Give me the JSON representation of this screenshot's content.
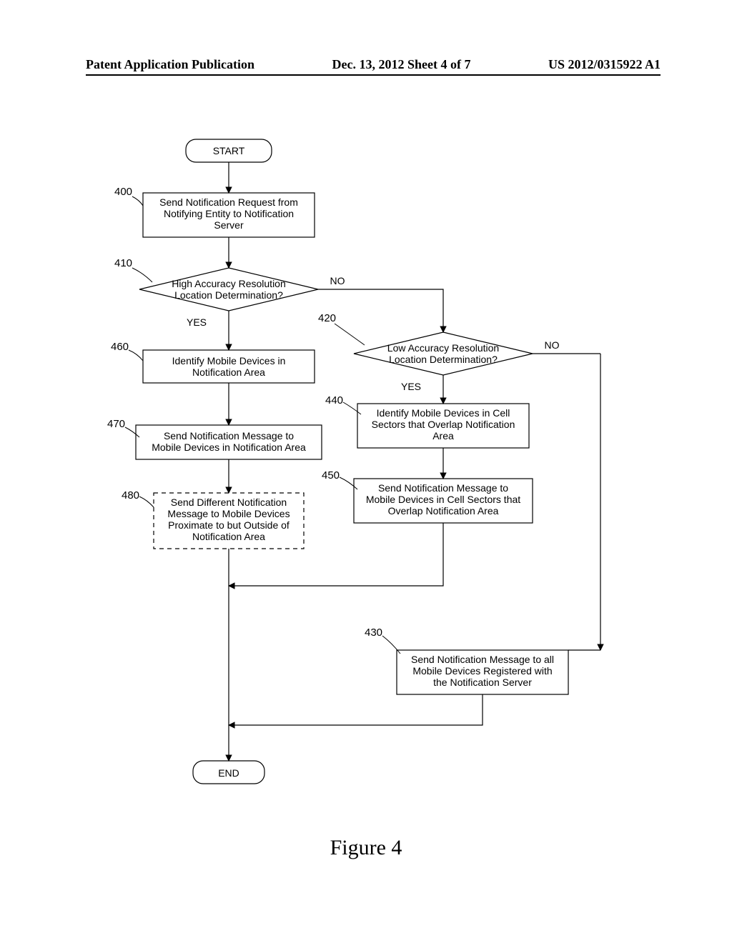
{
  "header": {
    "left": "Patent Application Publication",
    "center": "Dec. 13, 2012  Sheet 4 of 7",
    "right": "US 2012/0315922 A1"
  },
  "figure_caption": "Figure 4",
  "refs": {
    "r400": "400",
    "r410": "410",
    "r420": "420",
    "r430": "430",
    "r440": "440",
    "r450": "450",
    "r460": "460",
    "r470": "470",
    "r480": "480"
  },
  "labels": {
    "yes": "YES",
    "no": "NO"
  },
  "nodes": {
    "start": "START",
    "end": "END",
    "n400_l1": "Send Notification Request from",
    "n400_l2": "Notifying Entity to Notification",
    "n400_l3": "Server",
    "n410_l1": "High Accuracy Resolution",
    "n410_l2": "Location Determination?",
    "n420_l1": "Low Accuracy Resolution",
    "n420_l2": "Location Determination?",
    "n430_l1": "Send Notification Message to all",
    "n430_l2": "Mobile Devices Registered with",
    "n430_l3": "the Notification Server",
    "n440_l1": "Identify Mobile Devices in Cell",
    "n440_l2": "Sectors that Overlap Notification",
    "n440_l3": "Area",
    "n450_l1": "Send Notification Message to",
    "n450_l2": "Mobile Devices in Cell Sectors that",
    "n450_l3": "Overlap Notification Area",
    "n460_l1": "Identify Mobile Devices in",
    "n460_l2": "Notification Area",
    "n470_l1": "Send Notification Message to",
    "n470_l2": "Mobile Devices in Notification Area",
    "n480_l1": "Send Different Notification",
    "n480_l2": "Message to Mobile Devices",
    "n480_l3": "Proximate to but Outside of",
    "n480_l4": "Notification Area"
  }
}
